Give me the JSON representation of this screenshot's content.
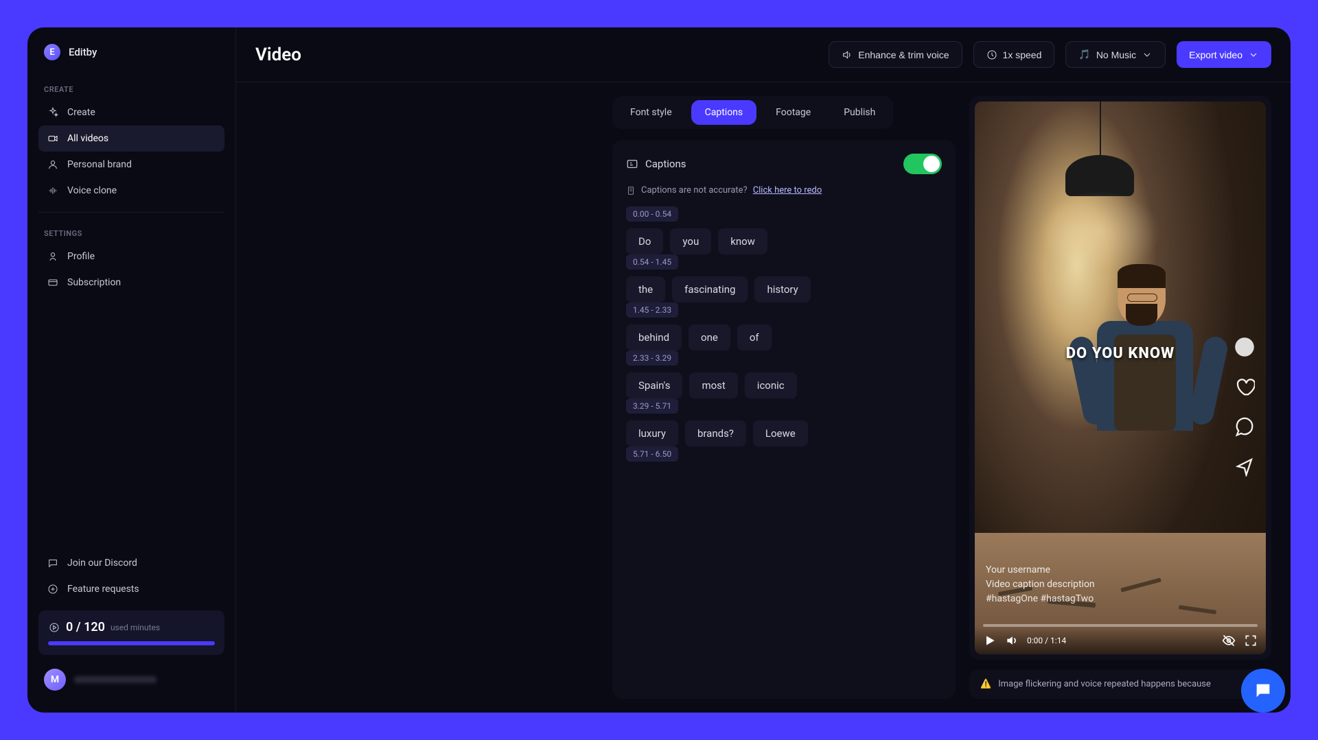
{
  "app": {
    "logo_letter": "E",
    "name": "Editby"
  },
  "sidebar": {
    "section_create": "CREATE",
    "section_settings": "SETTINGS",
    "items": {
      "create": "Create",
      "all_videos": "All videos",
      "personal_brand": "Personal brand",
      "voice_clone": "Voice clone",
      "profile": "Profile",
      "subscription": "Subscription",
      "discord": "Join our Discord",
      "feature_requests": "Feature requests"
    },
    "usage": {
      "used": "0 / 120",
      "label": "used minutes"
    },
    "avatar_letter": "M"
  },
  "header": {
    "title": "Video",
    "enhance": "Enhance & trim voice",
    "speed": "1x speed",
    "music": "No Music",
    "export": "Export video"
  },
  "tabs": {
    "font_style": "Font style",
    "captions": "Captions",
    "footage": "Footage",
    "publish": "Publish"
  },
  "captions": {
    "title": "Captions",
    "redo_prompt": "Captions are not accurate?",
    "redo_link": "Click here to redo",
    "blocks": [
      {
        "time": "0.00 - 0.54",
        "words": [
          "Do",
          "you",
          "know"
        ]
      },
      {
        "time": "0.54 - 1.45",
        "words": [
          "the",
          "fascinating",
          "history"
        ]
      },
      {
        "time": "1.45 - 2.33",
        "words": [
          "behind",
          "one",
          "of"
        ]
      },
      {
        "time": "2.33 - 3.29",
        "words": [
          "Spain's",
          "most",
          "iconic"
        ]
      },
      {
        "time": "3.29 - 5.71",
        "words": [
          "luxury",
          "brands?",
          "Loewe"
        ]
      },
      {
        "time": "5.71 - 6.50",
        "words": []
      }
    ]
  },
  "video": {
    "caption_text": "DO YOU KNOW",
    "username": "Your username",
    "description": "Video caption description",
    "hashtags": "#hastagOne #hastagTwo",
    "time": "0:00 / 1:14"
  },
  "warning": "Image flickering and voice repeated happens because"
}
